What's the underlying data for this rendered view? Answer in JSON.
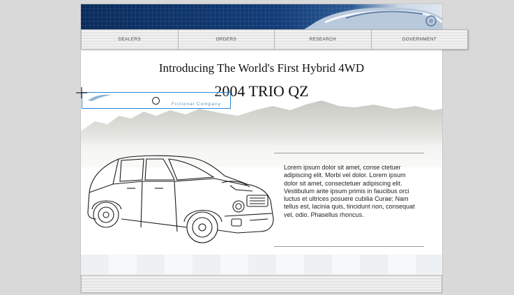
{
  "nav": {
    "items": [
      "DEALERS",
      "ORDERS",
      "RESEARCH",
      "GOVERNMENT"
    ]
  },
  "hero": {
    "headline": "Introducing The World's First Hybrid 4WD",
    "model": "2004 TRIO QZ"
  },
  "logo": {
    "company": "Fictional Company"
  },
  "body_text": "Lorem ipsum dolor sit amet, conse ctetuer adipiscing elit. Morbi vel dolor. Lorem ipsum dolor sit amet, consectetuer adipiscing elit. Vestibulum ante ipsum primis in faucibus orci luctus et ultrices posuere cubilia Curae; Nam tellus est, lacinia quis, tincidunt non, consequat vel, odio. Phasellus rhoncus.",
  "colors": {
    "banner": "#0a2c5c",
    "selection": "#2a86d8",
    "background": "#d9d9d9"
  }
}
